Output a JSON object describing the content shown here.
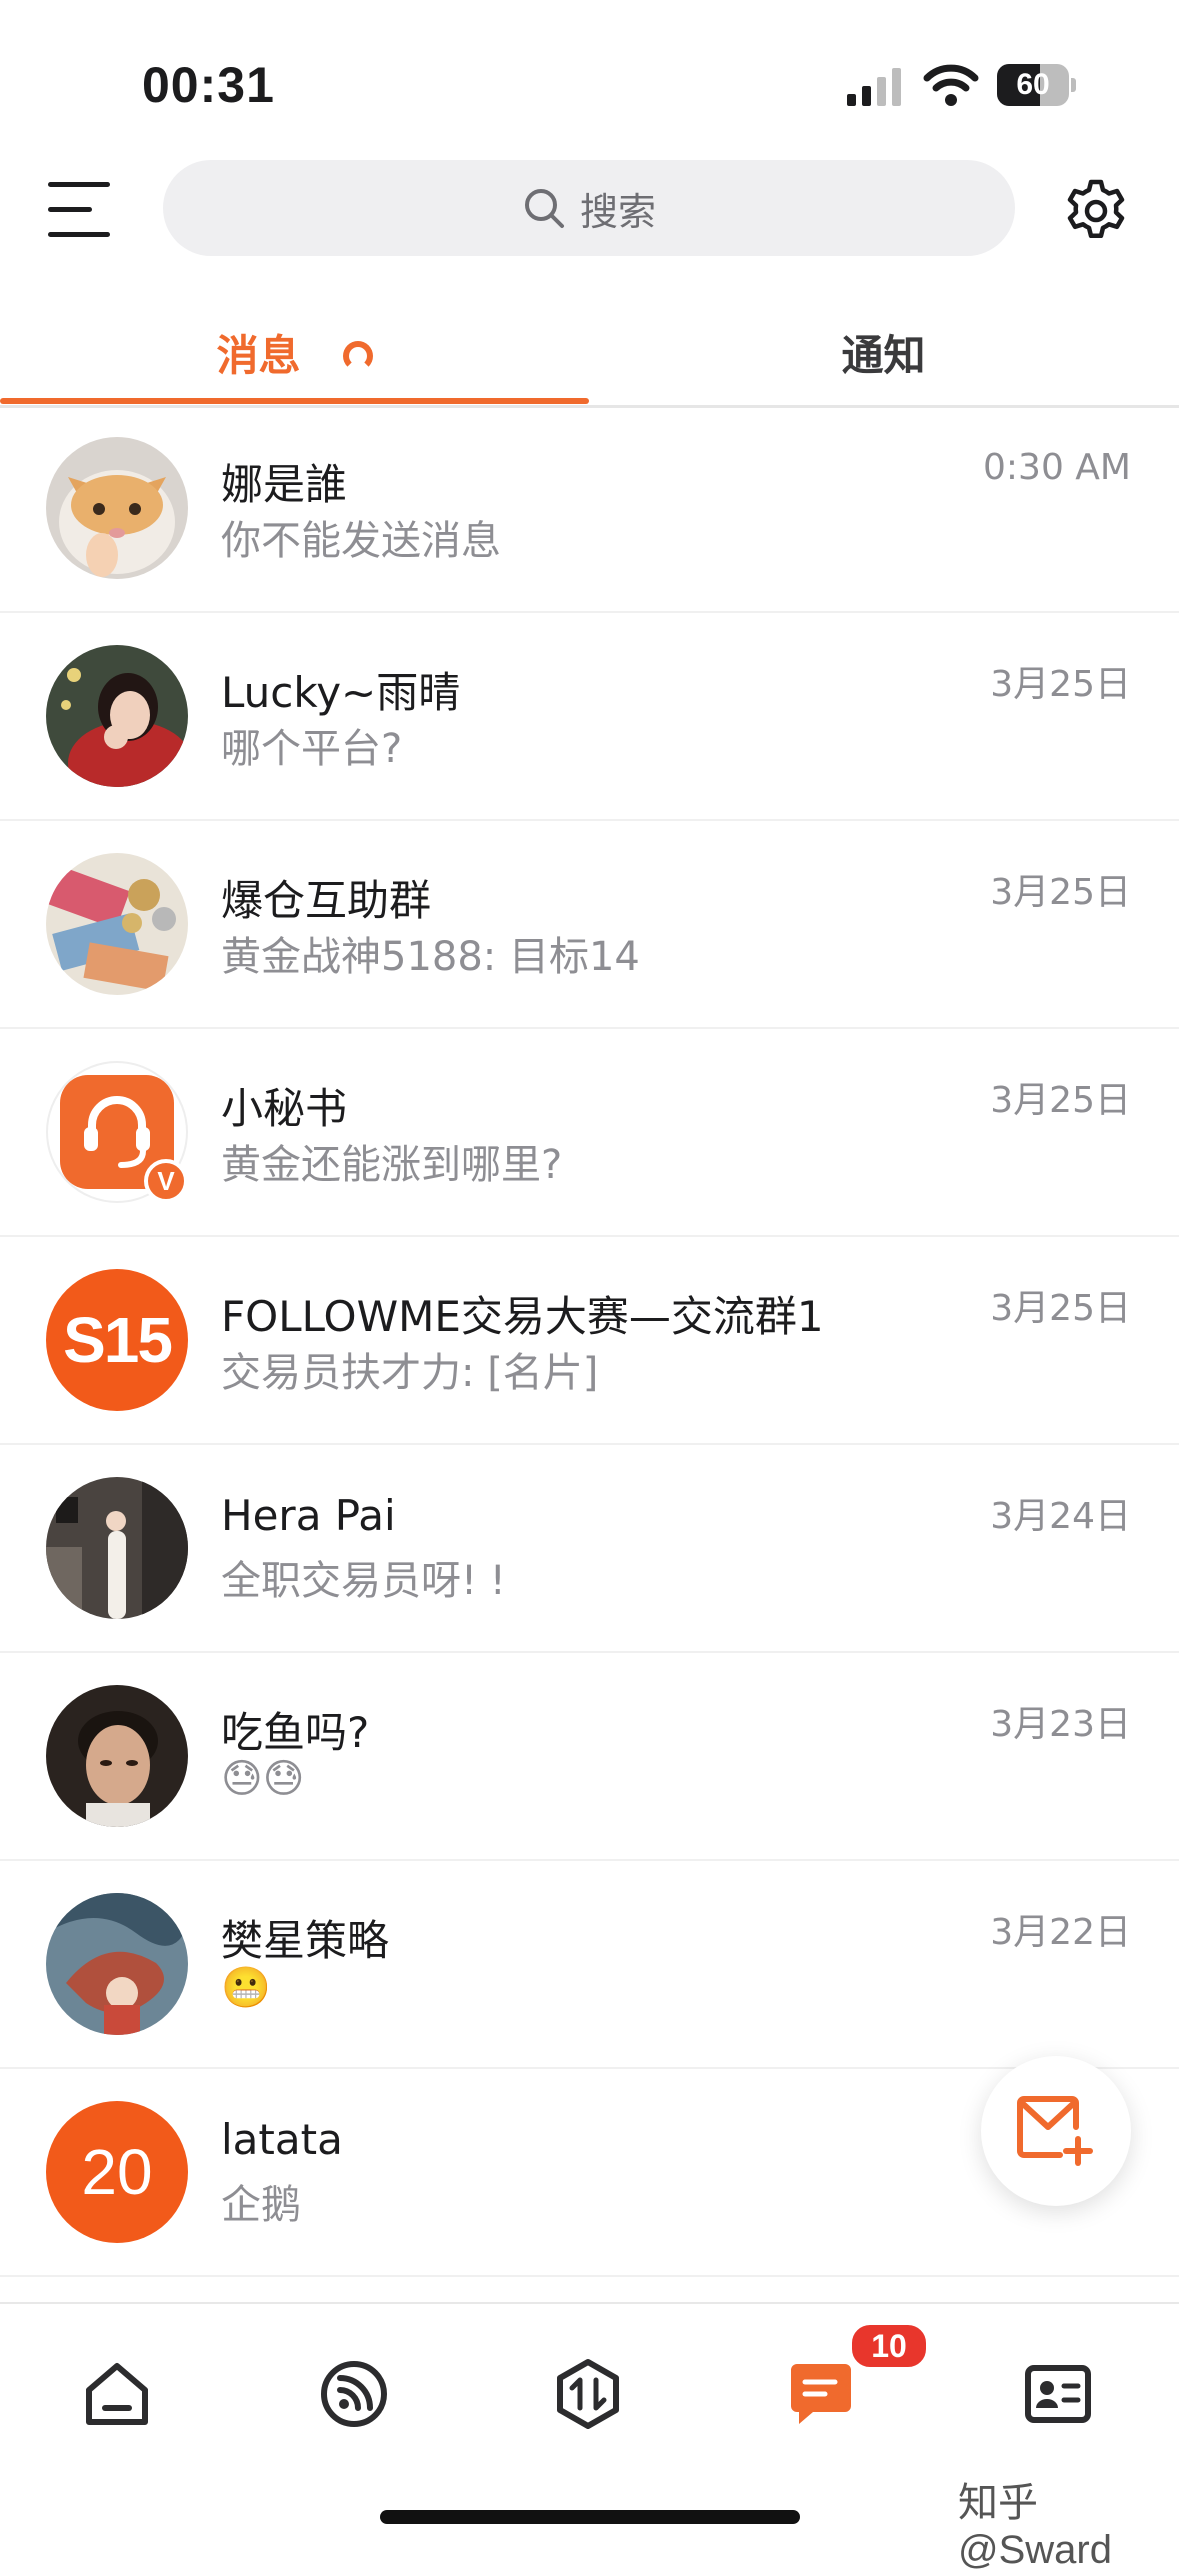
{
  "status_bar": {
    "time": "00:31",
    "battery": "60",
    "battery_level": 0.6
  },
  "header": {
    "search_placeholder": "搜索"
  },
  "tabs": [
    {
      "label": "消息",
      "active": true
    },
    {
      "label": "通知",
      "active": false
    }
  ],
  "conversations": [
    {
      "name": "娜是誰",
      "preview": "你不能发送消息",
      "date": "0:30 AM",
      "avatar": "cat-photo"
    },
    {
      "name": "Lucky~雨晴",
      "preview": "哪个平台?",
      "date": "3月25日",
      "avatar": "person-photo"
    },
    {
      "name": "爆仓互助群",
      "preview": "黄金战神5188: 目标14",
      "date": "3月25日",
      "avatar": "money-photo"
    },
    {
      "name": "小秘书",
      "preview": "黄金还能涨到哪里?",
      "date": "3月25日",
      "avatar": "headset-icon",
      "verified_badge": "V"
    },
    {
      "name": "FOLLOWME交易大赛—交流群1",
      "preview": "交易员扶才力: [名片]",
      "date": "3月25日",
      "avatar_text": "S15"
    },
    {
      "name": "Hera Pai",
      "preview": "全职交易员呀! !",
      "date": "3月24日",
      "avatar": "person-photo"
    },
    {
      "name": "吃鱼吗?",
      "preview": "😓😓",
      "date": "3月23日",
      "avatar": "person-photo"
    },
    {
      "name": "樊星策略",
      "preview": "😬",
      "date": "3月22日",
      "avatar": "dragon-art"
    },
    {
      "name": "latata",
      "preview": "企鹅",
      "date": "",
      "avatar_text": "20"
    }
  ],
  "bottom_nav": {
    "items": [
      "home-icon",
      "feed-icon",
      "trade-icon",
      "messages-icon",
      "contacts-icon"
    ],
    "active": "messages-icon",
    "messages_badge": "10"
  },
  "watermark": "知乎@Sward",
  "colors": {
    "accent": "#f06a2d",
    "badge": "#e8362c",
    "text": "#1c1c1e",
    "muted": "#8e8e93"
  }
}
